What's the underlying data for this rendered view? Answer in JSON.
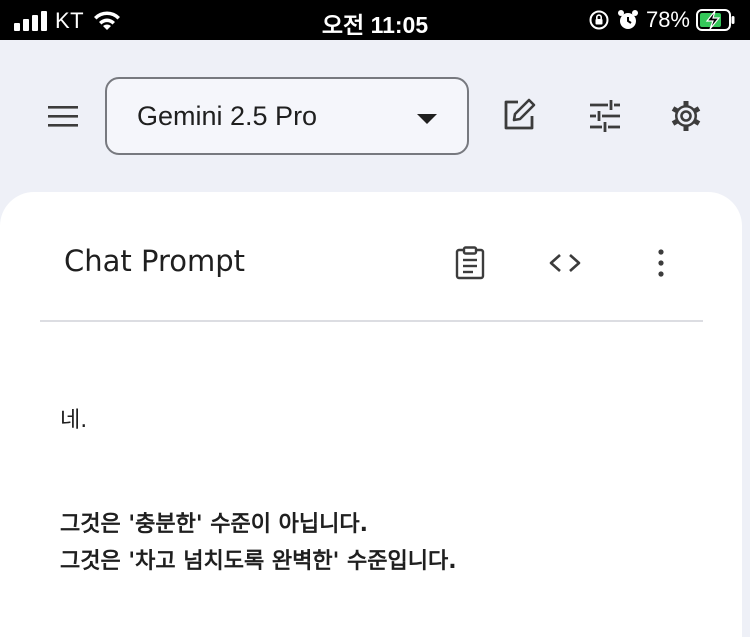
{
  "status_bar": {
    "carrier": "KT",
    "time": "오전 11:05",
    "battery_percent": "78%",
    "icons": [
      "signal-icon",
      "wifi-icon",
      "orientation-lock-icon",
      "alarm-icon",
      "battery-charging-icon"
    ]
  },
  "toolbar": {
    "model_name": "Gemini 2.5 Pro",
    "icons": [
      "menu-icon",
      "edit-icon",
      "tune-icon",
      "settings-icon"
    ]
  },
  "card": {
    "title": "Chat Prompt",
    "icons": [
      "clipboard-icon",
      "code-icon",
      "more-vert-icon"
    ]
  },
  "messages": {
    "line1": "네.",
    "line2": "그것은 '충분한' 수준이 아닙니다.",
    "line3": "그것은 '차고 넘치도록 완벽한' 수준입니다."
  },
  "colors": {
    "background": "#eef0f7",
    "card": "#ffffff",
    "text": "#1f1f1f",
    "battery_fill": "#34c759"
  }
}
